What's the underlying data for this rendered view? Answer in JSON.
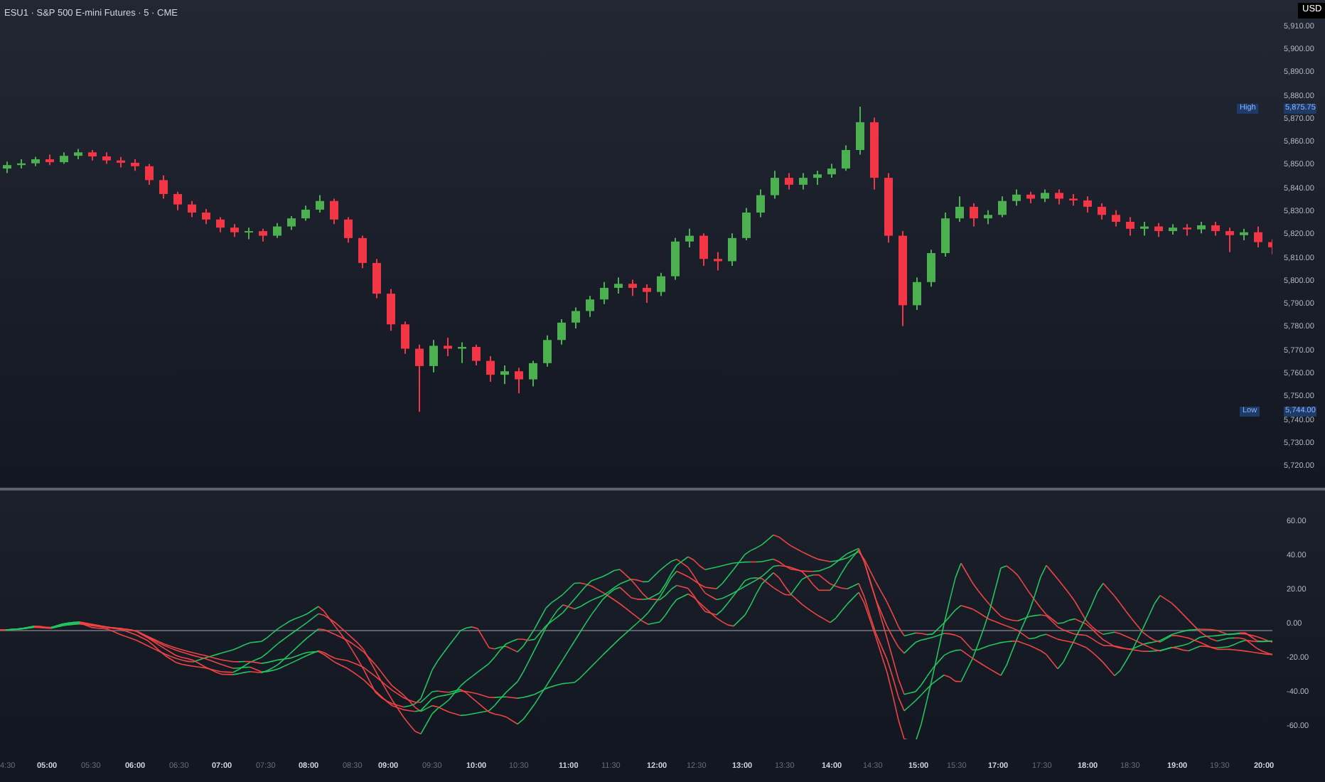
{
  "title": "ESU1 · S&P 500 E-mini Futures · 5 · CME",
  "currency": "USD",
  "price_chart": {
    "chart_data": {
      "type": "candlestick",
      "ylim": [
        5711.25,
        5921.75
      ],
      "yticks": [
        {
          "value": 5910,
          "label": "5,910.00"
        },
        {
          "value": 5900,
          "label": "5,900.00"
        },
        {
          "value": 5890,
          "label": "5,890.00"
        },
        {
          "value": 5880,
          "label": "5,880.00"
        },
        {
          "value": 5870,
          "label": "5,870.00"
        },
        {
          "value": 5860,
          "label": "5,860.00"
        },
        {
          "value": 5850,
          "label": "5,850.00"
        },
        {
          "value": 5840,
          "label": "5,840.00"
        },
        {
          "value": 5830,
          "label": "5,830.00"
        },
        {
          "value": 5820,
          "label": "5,820.00"
        },
        {
          "value": 5810,
          "label": "5,810.00"
        },
        {
          "value": 5800,
          "label": "5,800.00"
        },
        {
          "value": 5790,
          "label": "5,790.00"
        },
        {
          "value": 5780,
          "label": "5,780.00"
        },
        {
          "value": 5770,
          "label": "5,770.00"
        },
        {
          "value": 5760,
          "label": "5,760.00"
        },
        {
          "value": 5750,
          "label": "5,750.00"
        },
        {
          "value": 5740,
          "label": "5,740.00"
        },
        {
          "value": 5730,
          "label": "5,730.00"
        },
        {
          "value": 5720,
          "label": "5,720.00"
        }
      ],
      "categories": [
        null,
        null,
        null,
        null,
        null,
        null,
        null,
        null,
        null,
        null,
        null,
        null,
        null,
        null,
        null,
        null,
        null,
        null,
        null,
        null,
        null,
        null,
        null,
        null,
        null,
        null,
        null,
        null,
        null,
        null,
        null,
        null,
        null,
        null,
        null,
        null,
        null,
        null,
        null,
        null,
        null,
        null,
        null,
        null,
        null,
        null,
        null,
        null,
        null,
        null,
        null,
        null,
        null,
        null,
        null,
        null,
        null,
        null,
        null,
        null,
        null,
        null,
        null,
        null,
        null,
        null,
        null,
        null,
        null,
        null,
        null,
        null,
        null,
        null,
        null,
        null,
        null,
        null,
        null,
        null,
        null,
        null,
        null,
        null,
        null,
        null,
        null,
        null,
        null,
        null
      ],
      "ohlc": [
        [
          5849,
          5852,
          5847,
          5850.5
        ],
        [
          5850.5,
          5853,
          5849,
          5851.25
        ],
        [
          5851.25,
          5854,
          5850,
          5853
        ],
        [
          5853,
          5855,
          5850.5,
          5851.75
        ],
        [
          5851.75,
          5856,
          5851,
          5854.5
        ],
        [
          5854.5,
          5857.5,
          5853,
          5856
        ],
        [
          5856,
          5857,
          5852.5,
          5854.25
        ],
        [
          5854.25,
          5856,
          5851,
          5852.5
        ],
        [
          5852.5,
          5854,
          5849.5,
          5851.5
        ],
        [
          5851.5,
          5853,
          5848,
          5850
        ],
        [
          5850,
          5851,
          5842,
          5844
        ],
        [
          5844,
          5846,
          5836,
          5838
        ],
        [
          5838,
          5839,
          5831,
          5833.5
        ],
        [
          5833.5,
          5835,
          5828,
          5830
        ],
        [
          5830,
          5831.5,
          5825,
          5827
        ],
        [
          5827,
          5828,
          5821.5,
          5823.5
        ],
        [
          5823.5,
          5825,
          5819.5,
          5821.5
        ],
        [
          5821.5,
          5823.5,
          5818.5,
          5822
        ],
        [
          5822,
          5823,
          5817.5,
          5820
        ],
        [
          5820,
          5825.5,
          5819,
          5824
        ],
        [
          5824,
          5828.5,
          5822.5,
          5827.5
        ],
        [
          5827.5,
          5833,
          5826.5,
          5831.25
        ],
        [
          5831.25,
          5837.5,
          5830,
          5835
        ],
        [
          5835,
          5836,
          5825,
          5827
        ],
        [
          5827,
          5828,
          5817,
          5819
        ],
        [
          5819,
          5820,
          5806,
          5808.25
        ],
        [
          5808.25,
          5810,
          5793,
          5795
        ],
        [
          5795,
          5797,
          5779,
          5781.75
        ],
        [
          5781.75,
          5783,
          5769,
          5771.25
        ],
        [
          5771.25,
          5773,
          5744,
          5763.75
        ],
        [
          5763.75,
          5775,
          5761,
          5772.5
        ],
        [
          5772.5,
          5776,
          5768,
          5771.25
        ],
        [
          5771.25,
          5774,
          5765,
          5772
        ],
        [
          5772,
          5773,
          5764,
          5766
        ],
        [
          5766,
          5768,
          5757,
          5760
        ],
        [
          5760,
          5764,
          5756,
          5761.5
        ],
        [
          5761.5,
          5763,
          5752,
          5758
        ],
        [
          5758,
          5766,
          5755,
          5765
        ],
        [
          5765,
          5777,
          5763.5,
          5775
        ],
        [
          5775,
          5784,
          5773,
          5782.5
        ],
        [
          5782.5,
          5789,
          5780,
          5787.5
        ],
        [
          5787.5,
          5794,
          5785,
          5792.5
        ],
        [
          5792.5,
          5800,
          5790.5,
          5797.5
        ],
        [
          5797.5,
          5802,
          5795,
          5799.25
        ],
        [
          5799.25,
          5801,
          5794,
          5797.5
        ],
        [
          5797.5,
          5799,
          5791,
          5795.75
        ],
        [
          5795.75,
          5804,
          5794,
          5802.5
        ],
        [
          5802.5,
          5819,
          5801,
          5817.5
        ],
        [
          5817.5,
          5823,
          5815,
          5820
        ],
        [
          5820,
          5821,
          5807,
          5810
        ],
        [
          5810,
          5813,
          5805,
          5809
        ],
        [
          5809,
          5821,
          5807,
          5819
        ],
        [
          5819,
          5832,
          5818,
          5830
        ],
        [
          5830,
          5840,
          5828,
          5837.5
        ],
        [
          5837.5,
          5848,
          5836,
          5845
        ],
        [
          5845,
          5847,
          5840,
          5842
        ],
        [
          5842,
          5847,
          5840,
          5845
        ],
        [
          5845,
          5848,
          5842,
          5846.5
        ],
        [
          5846.5,
          5851,
          5845,
          5849
        ],
        [
          5849,
          5859,
          5848,
          5857
        ],
        [
          5857,
          5875.75,
          5855,
          5869
        ],
        [
          5869,
          5871,
          5840,
          5845
        ],
        [
          5845,
          5847,
          5817,
          5820
        ],
        [
          5820,
          5822,
          5781,
          5790
        ],
        [
          5790,
          5802,
          5788,
          5800
        ],
        [
          5800,
          5814,
          5798,
          5812.5
        ],
        [
          5812.5,
          5830,
          5811,
          5827.5
        ],
        [
          5827.5,
          5837,
          5826,
          5832.5
        ],
        [
          5832.5,
          5834,
          5824,
          5827.5
        ],
        [
          5827.5,
          5831,
          5825,
          5829
        ],
        [
          5829,
          5837,
          5828,
          5835
        ],
        [
          5835,
          5840,
          5833,
          5837.75
        ],
        [
          5837.75,
          5839,
          5834,
          5836
        ],
        [
          5836,
          5840,
          5834.5,
          5838.5
        ],
        [
          5838.5,
          5840,
          5833.5,
          5836
        ],
        [
          5836,
          5838,
          5833,
          5835.25
        ],
        [
          5835.25,
          5837,
          5830,
          5832.5
        ],
        [
          5832.5,
          5834,
          5827,
          5829
        ],
        [
          5829,
          5831,
          5824,
          5826
        ],
        [
          5826,
          5828,
          5820,
          5823
        ],
        [
          5823,
          5826,
          5820,
          5824
        ],
        [
          5824,
          5825.5,
          5819.5,
          5822
        ],
        [
          5822,
          5825,
          5820.5,
          5823.5
        ],
        [
          5823.5,
          5825,
          5820,
          5822.75
        ],
        [
          5822.75,
          5826,
          5821,
          5824.5
        ],
        [
          5824.5,
          5826,
          5820,
          5822
        ],
        [
          5822,
          5823.5,
          5813,
          5820.25
        ],
        [
          5820.25,
          5823,
          5818,
          5821.5
        ],
        [
          5821.5,
          5824,
          5815,
          5817.25
        ],
        [
          5817.25,
          5818.5,
          5812,
          5815
        ]
      ]
    }
  },
  "high_marker": {
    "label": "High",
    "value": "5,875.75"
  },
  "low_marker": {
    "label": "Low",
    "value": "5,744.00"
  },
  "oscillator_axis": [
    "60.00",
    "40.00",
    "20.00",
    "0.00",
    "-20.00",
    "-40.00",
    "-60.00"
  ],
  "time_axis": [
    {
      "text": "4:30",
      "bold": false
    },
    {
      "text": "05:00",
      "bold": true
    },
    {
      "text": "05:30",
      "bold": false
    },
    {
      "text": "06:00",
      "bold": true
    },
    {
      "text": "06:30",
      "bold": false
    },
    {
      "text": "07:00",
      "bold": true
    },
    {
      "text": "07:30",
      "bold": false
    },
    {
      "text": "08:00",
      "bold": true
    },
    {
      "text": "08:30",
      "bold": false
    },
    {
      "text": "09:00",
      "bold": true
    },
    {
      "text": "09:30",
      "bold": false
    },
    {
      "text": "10:00",
      "bold": true
    },
    {
      "text": "10:30",
      "bold": false
    },
    {
      "text": "11:00",
      "bold": true
    },
    {
      "text": "11:30",
      "bold": false
    },
    {
      "text": "12:00",
      "bold": true
    },
    {
      "text": "12:30",
      "bold": false
    },
    {
      "text": "13:00",
      "bold": true
    },
    {
      "text": "13:30",
      "bold": false
    },
    {
      "text": "14:00",
      "bold": true
    },
    {
      "text": "14:30",
      "bold": false
    },
    {
      "text": "15:00",
      "bold": true
    },
    {
      "text": "15:30",
      "bold": false
    },
    {
      "text": "17:00",
      "bold": true
    },
    {
      "text": "17:30",
      "bold": false
    },
    {
      "text": "18:00",
      "bold": true
    },
    {
      "text": "18:30",
      "bold": false
    },
    {
      "text": "19:00",
      "bold": true
    },
    {
      "text": "19:30",
      "bold": false
    },
    {
      "text": "20:00",
      "bold": true
    }
  ]
}
